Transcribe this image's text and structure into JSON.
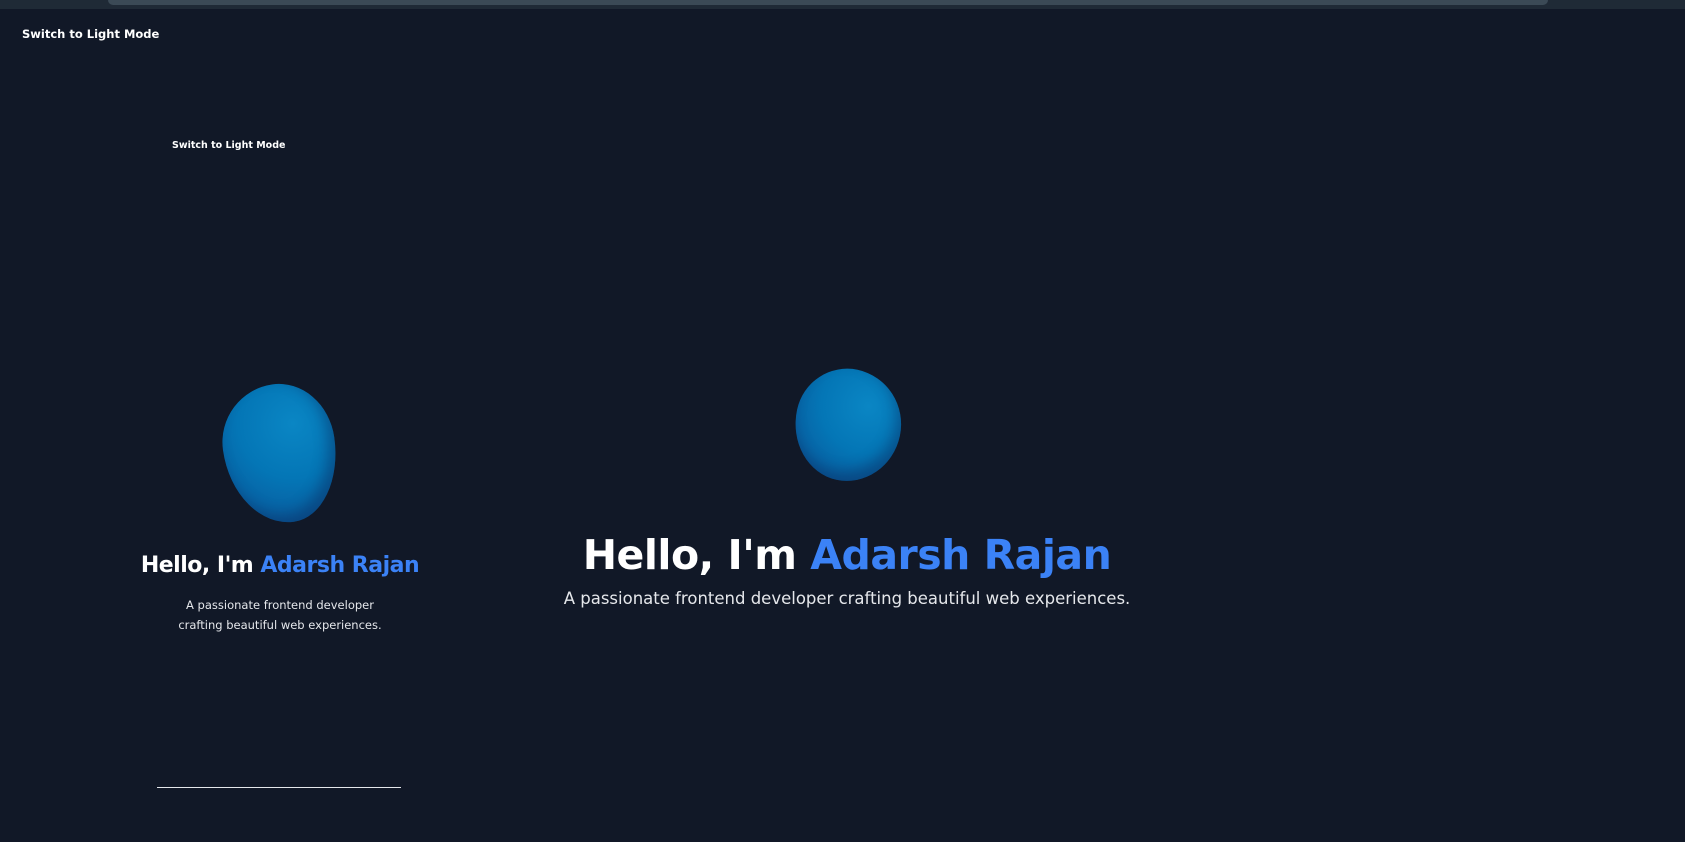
{
  "page": {
    "background_color": "#111827",
    "accent_color": "#3b82f6",
    "blob_color": "#0476b6"
  },
  "header": {
    "theme_toggle_label": "Switch to Light Mode"
  },
  "hero": {
    "greeting": "Hello, I'm ",
    "name": "Adarsh Rajan",
    "subtitle": "A passionate frontend developer crafting beautiful web experiences."
  },
  "preview": {
    "theme_toggle_label": "Switch to Light Mode",
    "greeting": "Hello, I'm ",
    "name": "Adarsh Rajan",
    "subtitle": "A passionate frontend developer crafting beautiful web experiences."
  }
}
